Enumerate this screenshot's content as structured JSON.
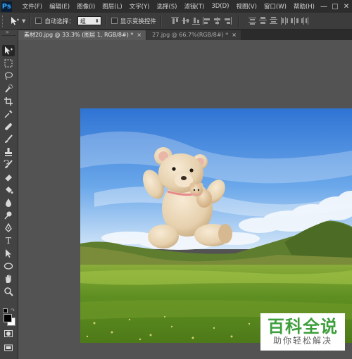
{
  "app": {
    "logo": "Ps"
  },
  "menu": {
    "items": [
      "文件(F)",
      "编辑(E)",
      "图像(I)",
      "图层(L)",
      "文字(Y)",
      "选择(S)",
      "滤镜(T)",
      "3D(D)",
      "视图(V)",
      "窗口(W)",
      "帮助(H)"
    ]
  },
  "window_controls": {
    "minimize": "—",
    "maximize": "□",
    "close": "✕"
  },
  "options": {
    "tool_icon": "move-tool-icon",
    "auto_select_label": "自动选择：",
    "auto_select_value": "组",
    "show_transform_label": "显示变换控件",
    "auto_select_checked": false,
    "show_transform_checked": false
  },
  "tabs": [
    {
      "label": "素材20.jpg @ 33.3% (图层 1, RGB/8#) *",
      "close": "×",
      "active": true
    },
    {
      "label": "27.jpg @ 66.7%(RGB/8#) *",
      "close": "×",
      "active": false
    }
  ],
  "tools": [
    "move-tool-icon",
    "marquee-tool-icon",
    "lasso-tool-icon",
    "quick-select-tool-icon",
    "crop-tool-icon",
    "eyedropper-tool-icon",
    "healing-brush-tool-icon",
    "brush-tool-icon",
    "clone-stamp-tool-icon",
    "history-brush-tool-icon",
    "eraser-tool-icon",
    "paint-bucket-tool-icon",
    "blur-tool-icon",
    "dodge-tool-icon",
    "pen-tool-icon",
    "type-tool-icon",
    "path-selection-tool-icon",
    "ellipse-tool-icon",
    "hand-tool-icon",
    "zoom-tool-icon"
  ],
  "type_tool_glyph": "T",
  "colors": {
    "foreground": "#000000",
    "background": "#ffffff",
    "menubar_bg": "#2d2d2d",
    "workspace_bg": "#535353",
    "brand_green": "#3e9e3c"
  },
  "watermark": {
    "main": "百科全说",
    "sub": "助你轻松解决"
  }
}
